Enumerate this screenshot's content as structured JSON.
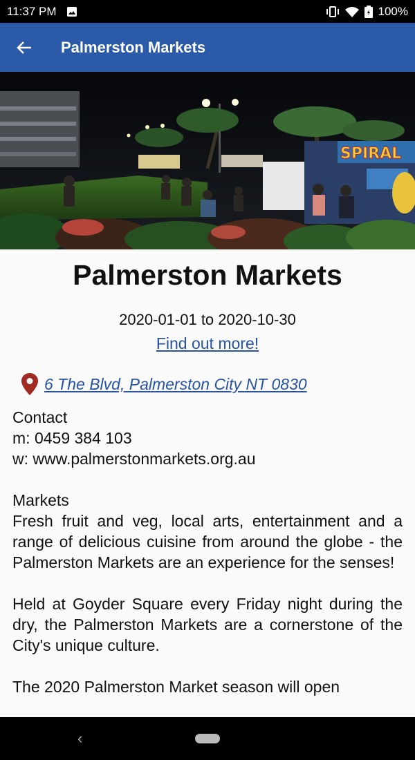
{
  "status": {
    "time": "11:37 PM",
    "battery": "100%",
    "icons": [
      "image-icon",
      "vibrate-icon",
      "wifi-icon",
      "battery-icon"
    ]
  },
  "appbar": {
    "title": "Palmerston Markets",
    "back_icon": "arrow-left-icon",
    "color": "#2a5aa8"
  },
  "hero": {
    "sign_text": "SPIRAL"
  },
  "event": {
    "title": "Palmerston Markets",
    "dates": "2020-01-01 to 2020-10-30",
    "more_link": "Find out more!",
    "address": " 6 The Blvd, Palmerston City NT 0830",
    "link_color": "#2753a2"
  },
  "details": {
    "contact_heading": "Contact",
    "phone": "m: 0459 384 103",
    "website": "w: www.palmerstonmarkets.org.au",
    "markets_heading": "Markets",
    "para1": "Fresh fruit and veg, local arts, entertainment and a range of delicious cuisine from around the globe - the Palmerston Markets are an experience for the senses!",
    "para2": "Held at Goyder Square every Friday night during the dry, the Palmerston Markets are a cornerstone of the City's unique culture.",
    "para3": "The 2020 Palmerston Market season will open"
  },
  "navbar": {
    "back_icon": "nav-back-icon",
    "home_icon": "nav-home-pill"
  }
}
